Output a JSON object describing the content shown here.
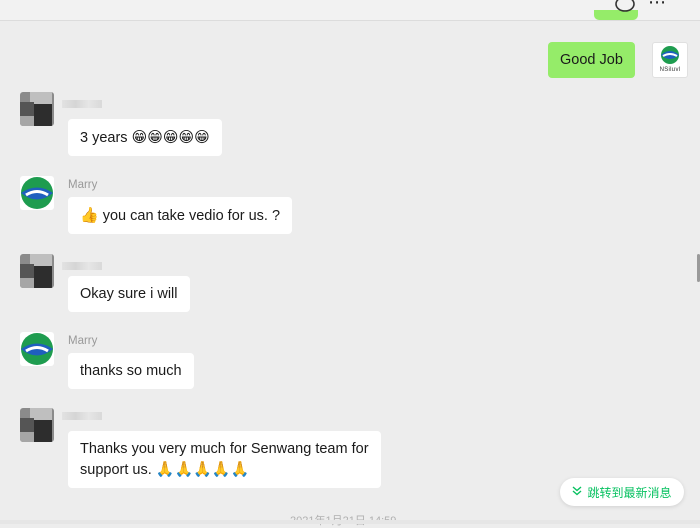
{
  "messages": [
    {
      "sender": "",
      "text": "Good Job",
      "mine": true
    },
    {
      "sender": "",
      "text": "3 years",
      "emoji": "😁😁😁😁😁"
    },
    {
      "sender": "Marry",
      "text": "you can take vedio for us. ?",
      "emoji_lead": "👍"
    },
    {
      "sender": "",
      "text": "Okay sure i will"
    },
    {
      "sender": "Marry",
      "text": "thanks so much"
    },
    {
      "sender": "",
      "text": "Thanks you very much for Senwang team for",
      "text2": "support us. ",
      "emoji": "🙏🙏🙏🙏🙏"
    }
  ],
  "self_avatar": {
    "caption": "NSiluvl",
    "icon": "company-logo-icon"
  },
  "jump_button": {
    "label": "跳转到最新消息",
    "icon": "double-chevron-down-icon"
  },
  "footer": {
    "timestamp": "2021年1月21日 14:59"
  },
  "colors": {
    "my_bubble": "#95ec69",
    "accent": "#07c160",
    "background": "#ededed"
  }
}
